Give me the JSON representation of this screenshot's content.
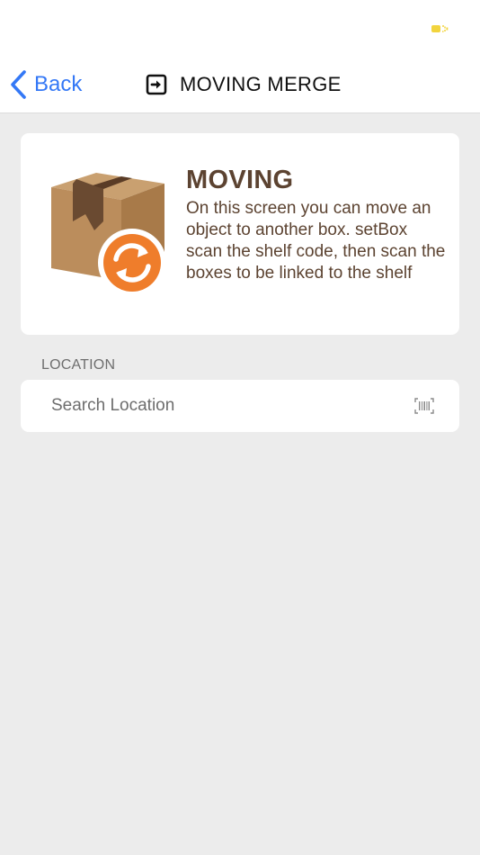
{
  "status_bar": {
    "battery_icon": "battery-charging-icon",
    "battery_color": "#f2d43d"
  },
  "nav": {
    "back_label": "Back",
    "back_icon": "chevron-left-icon",
    "title_icon": "exit-arrow-icon",
    "title": "MOVING MERGE",
    "accent_color": "#3478f6"
  },
  "info_card": {
    "illustration_icon": "cardboard-box-swap-icon",
    "heading": "MOVING",
    "description": "On this screen you can move an object to another box. setBox scan the shelf code, then scan the boxes to be linked to the shelf",
    "text_color": "#5c4331",
    "badge_color": "#ef7d2b"
  },
  "location": {
    "section_label": "LOCATION",
    "search_placeholder": "Search Location",
    "search_value": "",
    "scan_icon": "barcode-scan-icon"
  }
}
